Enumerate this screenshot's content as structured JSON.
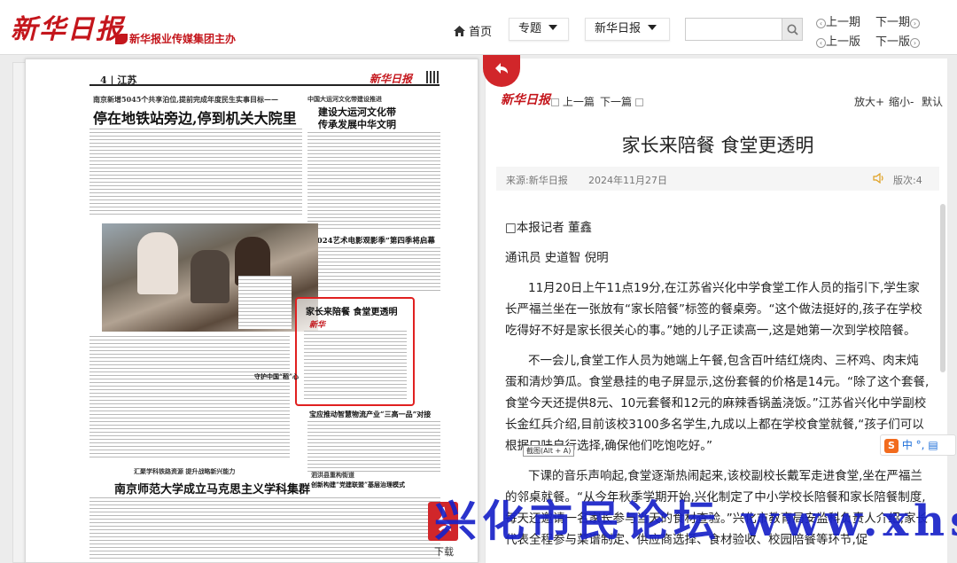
{
  "header": {
    "logo_text": "新华日报",
    "org_text": "新华报业传媒集团主办",
    "home_label": "首页",
    "topic_label": "专题",
    "paper_label": "新华日报",
    "search_placeholder": "",
    "prev_issue": "上一期",
    "next_issue": "下一期",
    "prev_page": "上一版",
    "next_page": "下一版"
  },
  "newspaper": {
    "page_no": "4",
    "section": "江苏",
    "logo": "新华日报",
    "kicker_main": "南京新增5045个共享泊位,提前完成年度民生实事目标——",
    "headline_main": "停在地铁站旁边,停到机关大院里",
    "kicker_right": "中国大运河文化带建设推进",
    "headline_right1": "建设大运河文化带",
    "headline_right2": "传承发展中华文明",
    "headline_right3": "“2024艺术电影观影季”第四季将启幕",
    "highlight_title": "家长来陪餐 食堂更透明",
    "highlight_logo": "新华",
    "headline_small1": "宝应推动智慧物流产业“三高一品”对接",
    "headline_small2": "守护中国“稻”心",
    "headline_bottom": "南京师范大学成立马克思主义学科集群",
    "headline_bottom2": "泗洪县重构街道",
    "headline_bottom3": "创新构建“党建联盟”基层治理模式",
    "headline_bottom4": "汇聚学科铁路资源 提升战略新兴能力"
  },
  "article": {
    "logo": "新华日报",
    "prev": "上一篇",
    "next": "下一篇",
    "zoom_in": "放大+",
    "zoom_out": "缩小-",
    "zoom_default": "默认",
    "title": "家长来陪餐 食堂更透明",
    "source": "来源:新华日报",
    "date": "2024年11月27日",
    "edition": "版次:4",
    "byline": "□本报记者 董鑫",
    "correspondents": "通讯员 史道智 倪明",
    "para1": "11月20日上午11点19分,在江苏省兴化中学食堂工作人员的指引下,学生家长严福兰坐在一张放有“家长陪餐”标签的餐桌旁。“这个做法挺好的,孩子在学校吃得好不好是家长很关心的事。”她的儿子正读高一,这是她第一次到学校陪餐。",
    "para2": "不一会儿,食堂工作人员为她端上午餐,包含百叶结红烧肉、三杯鸡、肉末炖蛋和清炒笋瓜。食堂悬挂的电子屏显示,这份套餐的价格是14元。“除了这个套餐,食堂今天还提供8元、10元套餐和12元的麻辣香锅盖浇饭。”江苏省兴化中学副校长金红兵介绍,目前该校3100多名学生,九成以上都在学校食堂就餐,“孩子们可以根据口味自行选择,确保他们吃饱吃好。”",
    "para3": "下课的音乐声响起,食堂逐渐热闹起来,该校副校长戴军走进食堂,坐在严福兰的邻桌就餐。“从今年秋季学期开始,兴化制定了中小学校长陪餐和家长陪餐制度,每天还邀请一名家长参与当天的食材查验。”兴化市教育局安监科负责人介绍,家长代表全程参与菜谱制定、供应商选择、食材验收、校园陪餐等环节,促"
  },
  "overlay": {
    "sogou": "中",
    "tooltip": "截图(Alt + A)",
    "download_label": "下载",
    "watermark": "兴化市民论坛 www.xhsml.com"
  },
  "colors": {
    "brand_red": "#c4161c",
    "highlight_border": "#e02020",
    "watermark_blue": "#1822c8"
  }
}
